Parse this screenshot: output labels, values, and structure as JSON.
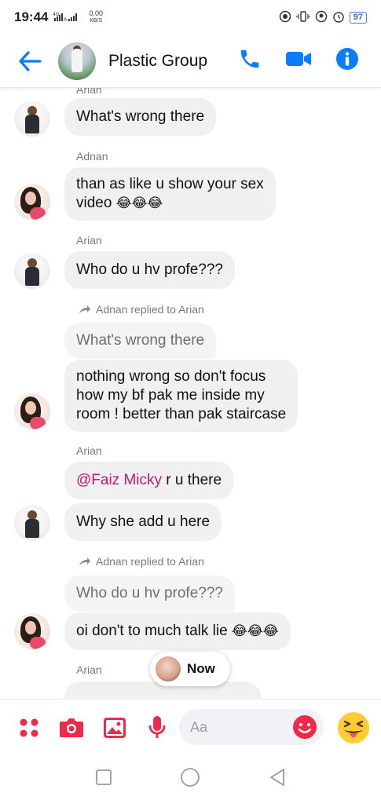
{
  "status_bar": {
    "time": "19:44",
    "signal_text": "4G",
    "speed_value": "0.00",
    "speed_unit": "KB/S",
    "battery": "97"
  },
  "header": {
    "title": "Plastic Group",
    "accent_color": "#0a7cff"
  },
  "messages": [
    {
      "sender": "Arian",
      "text": "What's  wrong there"
    },
    {
      "sender": "Adnan",
      "text_lines": [
        "than as like u show your sex",
        "video"
      ],
      "emojis": "😂😂😂"
    },
    {
      "sender": "Arian",
      "text": "Who do u hv profe???"
    },
    {
      "reply_notice": "Adnan replied to Arian",
      "quoted": "What's  wrong there",
      "text_lines": [
        "nothing wrong so don't focus",
        "how my bf pak me inside my",
        "room ! better than pak staircase"
      ]
    },
    {
      "sender": "Arian",
      "mention": "@Faiz Micky",
      "mention_rest": " r u there",
      "text": "Why she add u here"
    },
    {
      "reply_notice": "Adnan replied to Arian",
      "quoted": "Who do u hv profe???",
      "text": "oi don't to much talk lie",
      "emojis": "😂😂😂"
    },
    {
      "sender": "Arian"
    }
  ],
  "now_pill": {
    "label": "Now"
  },
  "composer": {
    "placeholder": "Aa"
  }
}
